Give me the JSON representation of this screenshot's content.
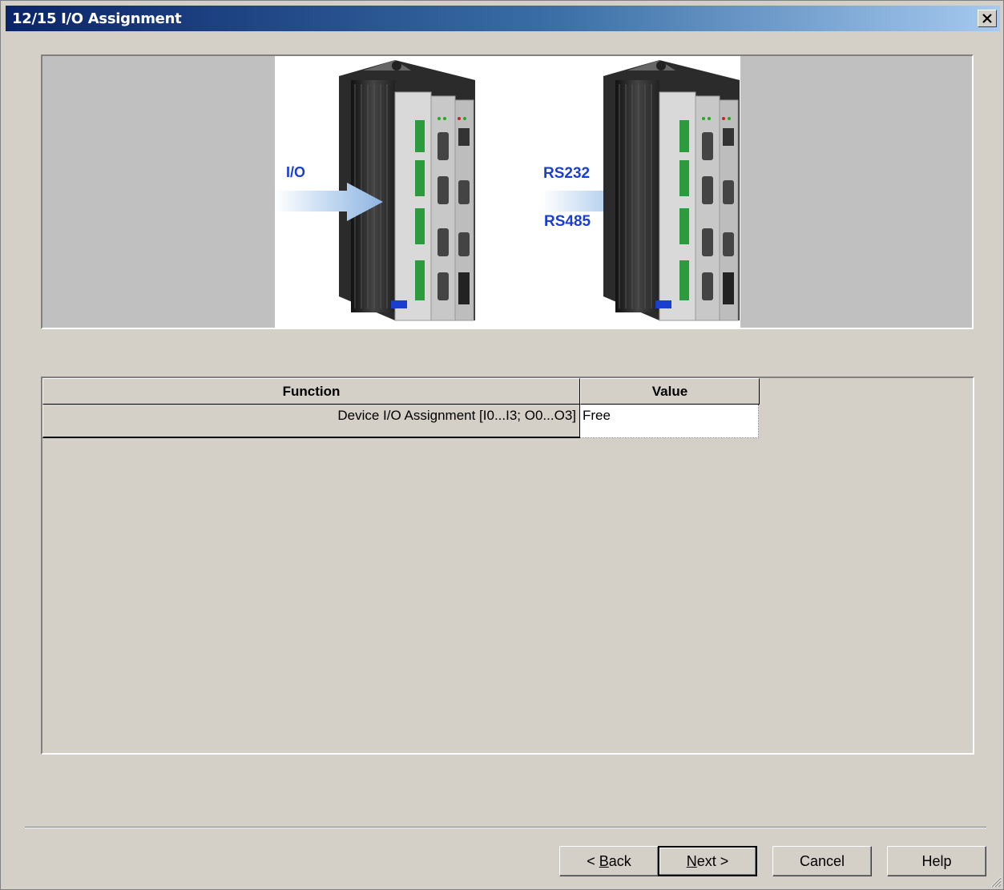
{
  "window": {
    "title": "12/15 I/O Assignment"
  },
  "diagram": {
    "label_io": "I/O",
    "label_rs232": "RS232",
    "label_rs485": "RS485"
  },
  "grid": {
    "columns": [
      "Function",
      "Value"
    ],
    "rows": [
      {
        "function": "Device I/O Assignment [I0...I3; O0...O3]",
        "value": "Free"
      }
    ]
  },
  "buttons": {
    "back_prefix": "< ",
    "back_key": "B",
    "back_rest": "ack",
    "next_key": "N",
    "next_rest": "ext >",
    "cancel": "Cancel",
    "help": "Help"
  },
  "colors": {
    "title_gradient_start": "#0a246a",
    "title_gradient_end": "#a6caf0",
    "label_blue": "#1a3fd0",
    "dialog_bg": "#d4d0c8"
  },
  "icons": {
    "close": "close-icon",
    "arrow_io": "arrow-right-icon",
    "arrow_serial": "arrow-right-icon",
    "resize": "resize-grip-icon"
  }
}
